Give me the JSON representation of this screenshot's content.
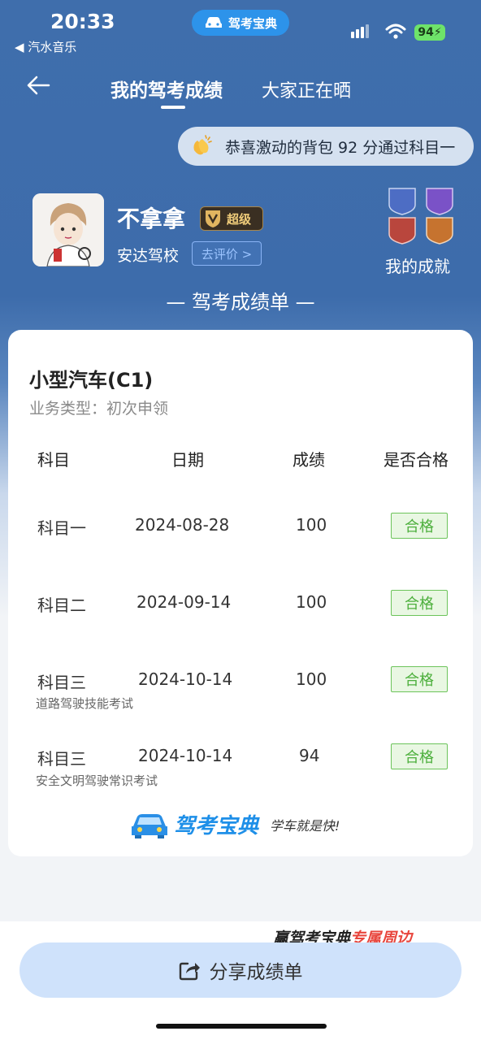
{
  "status": {
    "time": "20:33",
    "back_app": "◀ 汽水音乐",
    "app_pill": "驾考宝典",
    "battery": "94"
  },
  "header": {
    "tab_active": "我的驾考成绩",
    "tab_other": "大家正在晒"
  },
  "congrats": "恭喜激动的背包 92 分通过科目一",
  "profile": {
    "name": "不拿拿",
    "vip": "超级",
    "school": "安达驾校",
    "review": "去评价 >",
    "achievements": "我的成就"
  },
  "report_title": "— 驾考成绩单 —",
  "card": {
    "car_type": "小型汽车(C1)",
    "business": "业务类型：初次申领",
    "headers": {
      "subject": "科目",
      "date": "日期",
      "score": "成绩",
      "pass": "是否合格"
    },
    "rows": [
      {
        "subject": "科目一",
        "date": "2024-08-28",
        "score": "100",
        "pass": "合格",
        "note": ""
      },
      {
        "subject": "科目二",
        "date": "2024-09-14",
        "score": "100",
        "pass": "合格",
        "note": ""
      },
      {
        "subject": "科目三",
        "date": "2024-10-14",
        "score": "100",
        "pass": "合格",
        "note": "道路驾驶技能考试"
      },
      {
        "subject": "科目三",
        "date": "2024-10-14",
        "score": "94",
        "pass": "合格",
        "note": "安全文明驾驶常识考试"
      }
    ],
    "logo": "驾考宝典",
    "slogan": "学车就是快!"
  },
  "promo": {
    "part1": "赢驾考宝典",
    "part2": "专属周边"
  },
  "share_button": "分享成绩单",
  "colors": {
    "header_blue": "#3f6eac",
    "pass_green": "#4caf3c",
    "share_bg": "#cfe2fb"
  }
}
